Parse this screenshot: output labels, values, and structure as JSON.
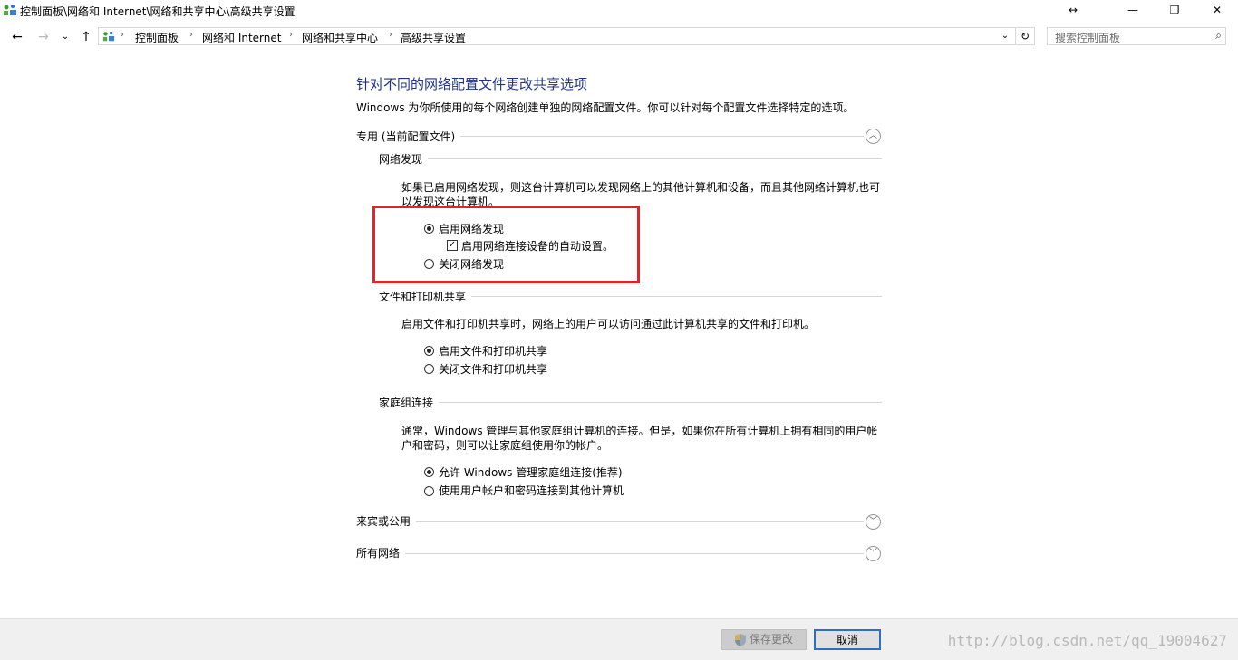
{
  "window": {
    "title": "控制面板\\网络和 Internet\\网络和共享中心\\高级共享设置",
    "controls": {
      "restore_size": "↔",
      "minimize": "—",
      "maximize": "❐",
      "close": "✕"
    }
  },
  "nav": {
    "back": "←",
    "forward": "→",
    "recent": "⌄",
    "up": "↑"
  },
  "address": {
    "breadcrumbs": [
      "控制面板",
      "网络和 Internet",
      "网络和共享中心",
      "高级共享设置"
    ],
    "separator": "›",
    "dropdown": "⌄",
    "refresh": "↻"
  },
  "search": {
    "placeholder": "搜索控制面板",
    "icon": "⌕"
  },
  "content": {
    "title": "针对不同的网络配置文件更改共享选项",
    "description": "Windows 为你所使用的每个网络创建单独的网络配置文件。你可以针对每个配置文件选择特定的选项。",
    "private_profile": {
      "label": "专用 (当前配置文件)",
      "expanded": true,
      "chevron": "︿",
      "network_discovery": {
        "heading": "网络发现",
        "description": "如果已启用网络发现，则这台计算机可以发现网络上的其他计算机和设备，而且其他网络计算机也可以发现这台计算机。",
        "option_on": "启用网络发现",
        "auto_setup": "启用网络连接设备的自动设置。",
        "auto_setup_check": "✓",
        "option_off": "关闭网络发现"
      },
      "file_printer": {
        "heading": "文件和打印机共享",
        "description": "启用文件和打印机共享时，网络上的用户可以访问通过此计算机共享的文件和打印机。",
        "option_on": "启用文件和打印机共享",
        "option_off": "关闭文件和打印机共享"
      },
      "homegroup": {
        "heading": "家庭组连接",
        "description": "通常，Windows 管理与其他家庭组计算机的连接。但是，如果你在所有计算机上拥有相同的用户帐户和密码，则可以让家庭组使用你的帐户。",
        "option_allow": "允许 Windows 管理家庭组连接(推荐)",
        "option_account": "使用用户帐户和密码连接到其他计算机"
      }
    },
    "guest_profile": {
      "label": "来宾或公用",
      "chevron": "﹀"
    },
    "all_networks": {
      "label": "所有网络",
      "chevron": "﹀"
    }
  },
  "footer": {
    "save_label": "保存更改",
    "save_icon": "shield-icon",
    "cancel_label": "取消",
    "watermark": "http://blog.csdn.net/qq_19004627"
  },
  "colors": {
    "title_blue": "#1e3287",
    "highlight_red": "#e3232c"
  }
}
